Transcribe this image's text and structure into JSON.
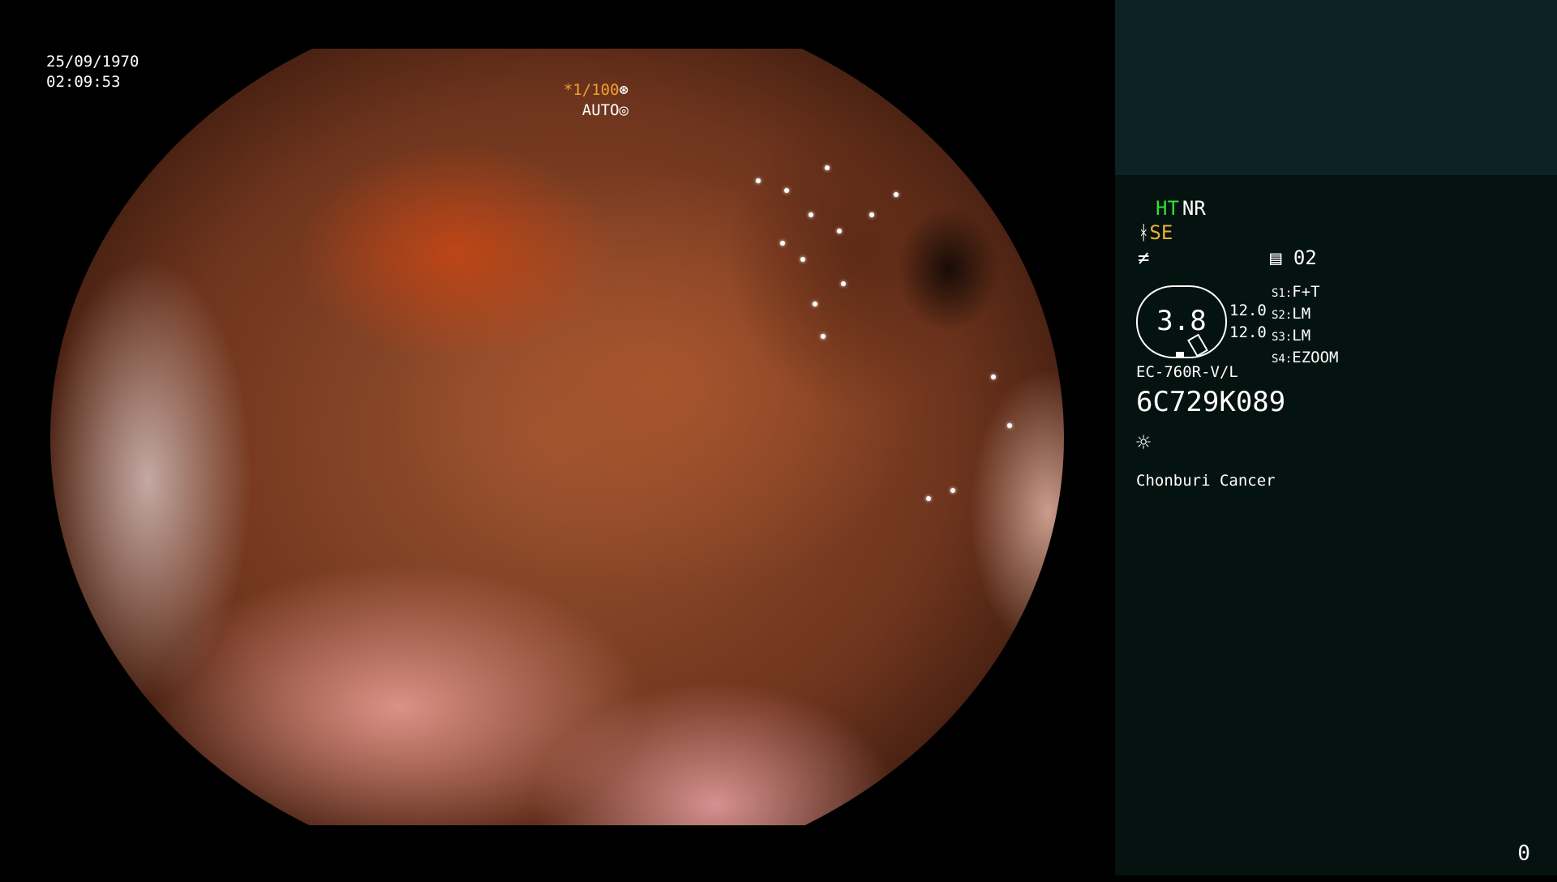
{
  "overlay": {
    "date": "25/09/1970",
    "time": "02:09:53",
    "shutter": "*1/100",
    "shutter_icon": "shutter-icon",
    "iris": "AUTO",
    "iris_icon": "iris-icon"
  },
  "panel": {
    "ht": "HT",
    "nr": "NR",
    "se": "SE",
    "se_icon": "structure-enhance-icon",
    "enhance_icon": "color-enhance-icon",
    "memo": "02",
    "memo_icon": "memo-icon",
    "dial_value": "3.8",
    "dial_a": "12.0",
    "dial_b": "12.0",
    "scopes": [
      {
        "key": "S1:",
        "val": "F+T"
      },
      {
        "key": "S2:",
        "val": "LM"
      },
      {
        "key": "S3:",
        "val": "LM"
      },
      {
        "key": "S4:",
        "val": "EZOOM"
      }
    ],
    "model": "EC-760R-V/L",
    "serial": "6C729K089",
    "light_icon": "light-source-icon",
    "institution": "Chonburi Cancer",
    "count": "0"
  },
  "colors": {
    "ht": "#30e030",
    "se": "#f0b030",
    "shutter": "#f0a030",
    "panel_bg": "#041210",
    "panel_top_bg": "#0c2224"
  }
}
